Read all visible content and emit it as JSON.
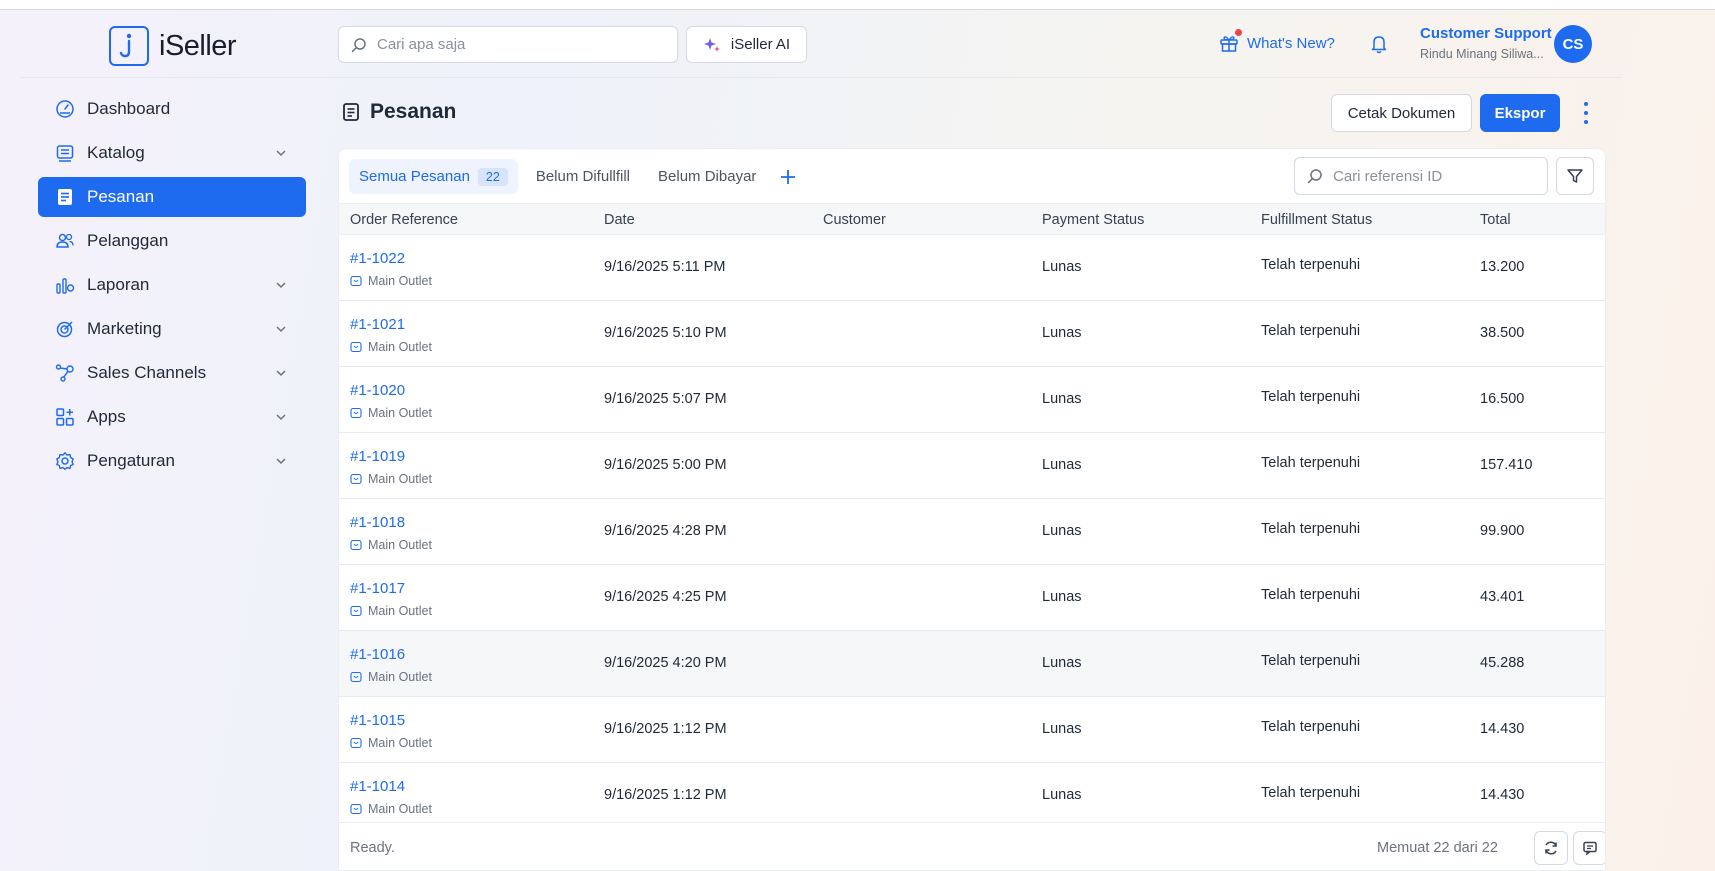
{
  "app": {
    "logo_text": "iSeller"
  },
  "header": {
    "search_placeholder": "Cari apa saja",
    "ai_label": "iSeller AI",
    "whats_new": "What's New?",
    "user_name": "Customer Support",
    "user_store": "Rindu Minang Siliwa...",
    "avatar_initials": "CS"
  },
  "sidebar": {
    "items": [
      {
        "label": "Dashboard",
        "icon": "dashboard-icon",
        "chevron": false,
        "active": false
      },
      {
        "label": "Katalog",
        "icon": "catalog-icon",
        "chevron": true,
        "active": false
      },
      {
        "label": "Pesanan",
        "icon": "orders-icon",
        "chevron": false,
        "active": true
      },
      {
        "label": "Pelanggan",
        "icon": "customers-icon",
        "chevron": false,
        "active": false
      },
      {
        "label": "Laporan",
        "icon": "reports-icon",
        "chevron": true,
        "active": false
      },
      {
        "label": "Marketing",
        "icon": "marketing-icon",
        "chevron": true,
        "active": false
      },
      {
        "label": "Sales Channels",
        "icon": "sales-channels-icon",
        "chevron": true,
        "active": false
      },
      {
        "label": "Apps",
        "icon": "apps-icon",
        "chevron": true,
        "active": false
      },
      {
        "label": "Pengaturan",
        "icon": "settings-icon",
        "chevron": true,
        "active": false
      }
    ]
  },
  "page": {
    "title": "Pesanan",
    "print_button": "Cetak Dokumen",
    "export_button": "Ekspor"
  },
  "tabs": [
    {
      "label": "Semua Pesanan",
      "count": "22",
      "active": true
    },
    {
      "label": "Belum Difullfill",
      "active": false
    },
    {
      "label": "Belum Dibayar",
      "active": false
    }
  ],
  "ref_search_placeholder": "Cari referensi ID",
  "table": {
    "columns": [
      "Order Reference",
      "Date",
      "Customer",
      "Payment Status",
      "Fulfillment Status",
      "Total"
    ],
    "rows": [
      {
        "ref": "#1-1022",
        "outlet": "Main Outlet",
        "date": "9/16/2025 5:11 PM",
        "customer": "",
        "payment": "Lunas",
        "fulfillment": "Telah terpenuhi",
        "total": "13.200"
      },
      {
        "ref": "#1-1021",
        "outlet": "Main Outlet",
        "date": "9/16/2025 5:10 PM",
        "customer": "",
        "payment": "Lunas",
        "fulfillment": "Telah terpenuhi",
        "total": "38.500"
      },
      {
        "ref": "#1-1020",
        "outlet": "Main Outlet",
        "date": "9/16/2025 5:07 PM",
        "customer": "",
        "payment": "Lunas",
        "fulfillment": "Telah terpenuhi",
        "total": "16.500"
      },
      {
        "ref": "#1-1019",
        "outlet": "Main Outlet",
        "date": "9/16/2025 5:00 PM",
        "customer": "",
        "payment": "Lunas",
        "fulfillment": "Telah terpenuhi",
        "total": "157.410"
      },
      {
        "ref": "#1-1018",
        "outlet": "Main Outlet",
        "date": "9/16/2025 4:28 PM",
        "customer": "",
        "payment": "Lunas",
        "fulfillment": "Telah terpenuhi",
        "total": "99.900"
      },
      {
        "ref": "#1-1017",
        "outlet": "Main Outlet",
        "date": "9/16/2025 4:25 PM",
        "customer": "",
        "payment": "Lunas",
        "fulfillment": "Telah terpenuhi",
        "total": "43.401"
      },
      {
        "ref": "#1-1016",
        "outlet": "Main Outlet",
        "date": "9/16/2025 4:20 PM",
        "customer": "",
        "payment": "Lunas",
        "fulfillment": "Telah terpenuhi",
        "total": "45.288"
      },
      {
        "ref": "#1-1015",
        "outlet": "Main Outlet",
        "date": "9/16/2025 1:12 PM",
        "customer": "",
        "payment": "Lunas",
        "fulfillment": "Telah terpenuhi",
        "total": "14.430"
      },
      {
        "ref": "#1-1014",
        "outlet": "Main Outlet",
        "date": "9/16/2025 1:12 PM",
        "customer": "",
        "payment": "Lunas",
        "fulfillment": "Telah terpenuhi",
        "total": "14.430"
      }
    ]
  },
  "footer": {
    "status": "Ready.",
    "loaded": "Memuat 22 dari 22"
  },
  "colors": {
    "accent": "#1e6bf0",
    "notification_dot": "#ef4444"
  }
}
